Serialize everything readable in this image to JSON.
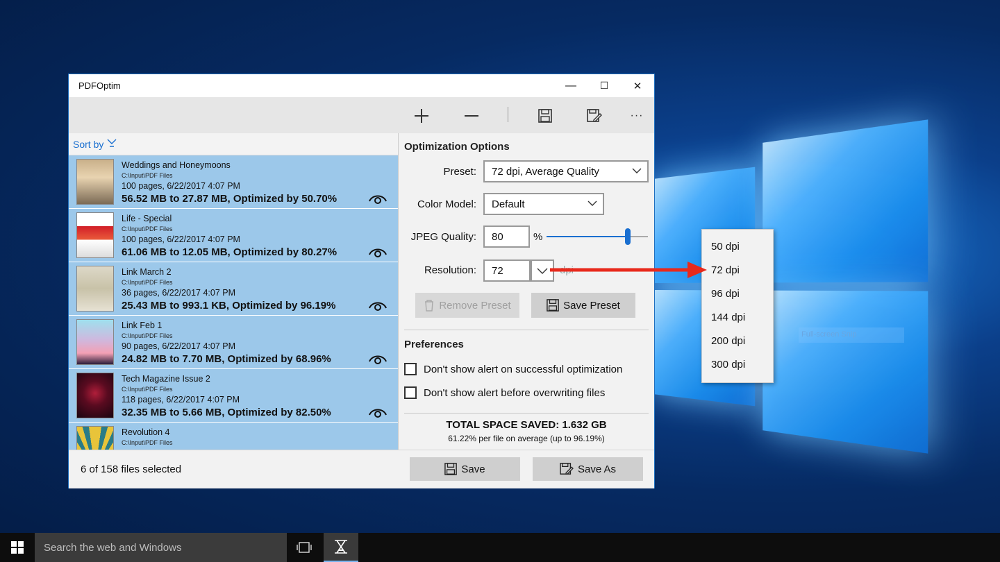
{
  "window": {
    "title": "PDFOptim",
    "controls": {
      "minimize": "—",
      "maximize": "☐",
      "close": "✕"
    }
  },
  "toolbar": {
    "icons": [
      "add-icon",
      "remove-icon",
      "save-icon",
      "save-as-icon",
      "more-icon"
    ],
    "more_label": "···"
  },
  "list": {
    "sort_label": "Sort by",
    "items": [
      {
        "title": "Weddings and Honeymoons",
        "path": "C:\\Input\\PDF Files",
        "meta": "100 pages, 6/22/2017 4:07 PM",
        "result": "56.52 MB to 27.87 MB, Optimized by 50.70%"
      },
      {
        "title": "Life - Special",
        "path": "C:\\Input\\PDF Files",
        "meta": "100 pages, 6/22/2017 4:07 PM",
        "result": "61.06 MB to 12.05 MB, Optimized by 80.27%"
      },
      {
        "title": "Link March 2",
        "path": "C:\\Input\\PDF Files",
        "meta": "36 pages, 6/22/2017 4:07 PM",
        "result": "25.43 MB to 993.1 KB, Optimized by 96.19%"
      },
      {
        "title": "Link Feb 1",
        "path": "C:\\Input\\PDF Files",
        "meta": "90 pages, 6/22/2017 4:07 PM",
        "result": "24.82 MB to 7.70 MB, Optimized by 68.96%"
      },
      {
        "title": "Tech Magazine Issue 2",
        "path": "C:\\Input\\PDF Files",
        "meta": "118 pages, 6/22/2017 4:07 PM",
        "result": "32.35 MB to 5.66 MB, Optimized by 82.50%"
      },
      {
        "title": "Revolution 4",
        "path": "C:\\Input\\PDF Files",
        "meta": "",
        "result": ""
      }
    ],
    "selection_info": "6 of 158 files selected"
  },
  "options": {
    "heading": "Optimization Options",
    "preset_label": "Preset:",
    "preset_value": "72 dpi, Average Quality",
    "color_model_label": "Color Model:",
    "color_model_value": "Default",
    "jpeg_label": "JPEG Quality:",
    "jpeg_value": "80",
    "jpeg_unit": "%",
    "jpeg_slider_fraction": 0.8,
    "resolution_label": "Resolution:",
    "resolution_value": "72",
    "resolution_unit": "dpi",
    "remove_preset": "Remove Preset",
    "save_preset": "Save Preset"
  },
  "preferences": {
    "heading": "Preferences",
    "opt1": "Don't show alert on successful optimization",
    "opt2": "Don't show alert before overwriting files"
  },
  "summary": {
    "total": "TOTAL SPACE SAVED: 1.632 GB",
    "detail": "61.22% per file on average (up to 96.19%)"
  },
  "bottom": {
    "save": "Save",
    "save_as": "Save As"
  },
  "dropdown": {
    "options": [
      "50 dpi",
      "72 dpi",
      "96 dpi",
      "144 dpi",
      "200 dpi",
      "300 dpi"
    ]
  },
  "desktop": {
    "ghost_text": "Full-screen Snip"
  },
  "taskbar": {
    "search_placeholder": "Search the web and Windows"
  },
  "colors": {
    "accent": "#1a6fd0",
    "list_selected": "#9cc8ea",
    "annotation_arrow": "#e8291c"
  }
}
